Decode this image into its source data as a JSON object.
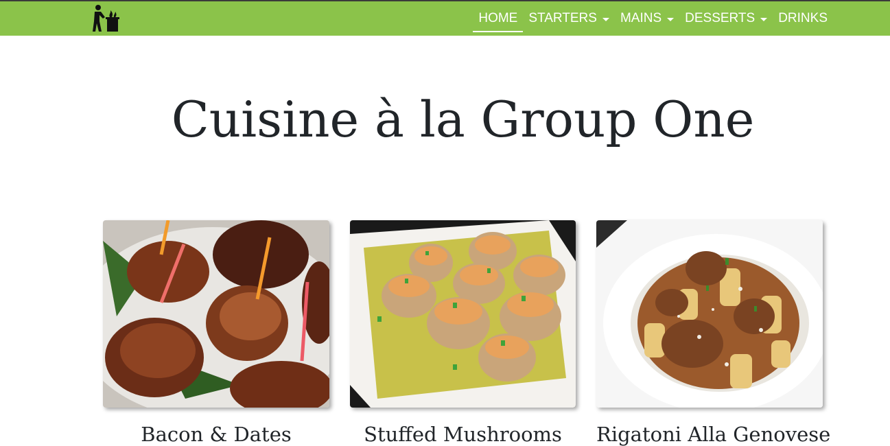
{
  "navbar": {
    "logo_icon": "chef-cooking-icon",
    "background_color": "#8bc34a",
    "items": [
      {
        "label": "HOME",
        "active": true,
        "dropdown": false
      },
      {
        "label": "STARTERS",
        "active": false,
        "dropdown": true
      },
      {
        "label": "MAINS",
        "active": false,
        "dropdown": true
      },
      {
        "label": "DESSERTS",
        "active": false,
        "dropdown": true
      },
      {
        "label": "DRINKS",
        "active": false,
        "dropdown": false
      }
    ]
  },
  "main": {
    "title": "Cuisine à la Group One",
    "cards": [
      {
        "title": "Bacon & Dates",
        "image": "bacon-wrapped-dates-photo"
      },
      {
        "title": "Stuffed Mushrooms",
        "image": "stuffed-mushrooms-photo"
      },
      {
        "title": "Rigatoni Alla Genovese",
        "image": "rigatoni-genovese-photo"
      }
    ]
  }
}
